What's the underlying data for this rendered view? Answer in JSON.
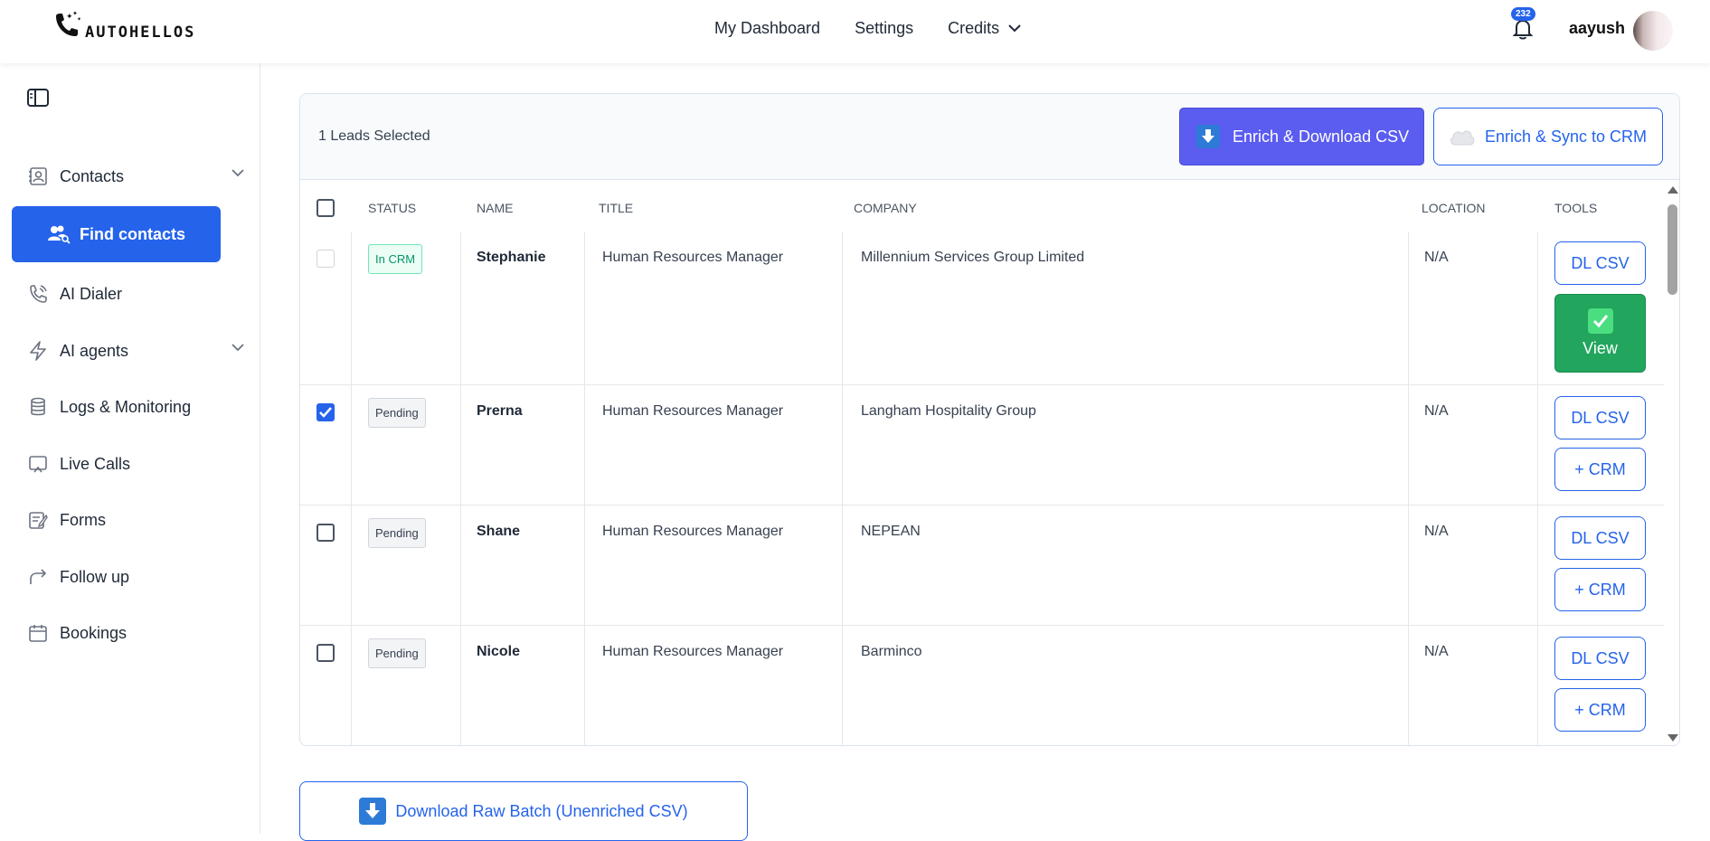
{
  "brand": {
    "logo_text": "AUTOHELLOS"
  },
  "nav": {
    "links": [
      "My Dashboard",
      "Settings",
      "Credits"
    ],
    "notifications_count": "232",
    "username": "aayush"
  },
  "sidebar": {
    "items": [
      {
        "label": "Contacts",
        "icon": "contacts-icon",
        "has_chevron": true
      },
      {
        "label": "Find contacts",
        "icon": "users-search-icon",
        "active": true
      },
      {
        "label": "AI Dialer",
        "icon": "phone-icon"
      },
      {
        "label": "AI agents",
        "icon": "bolt-icon",
        "has_chevron": true
      },
      {
        "label": "Logs & Monitoring",
        "icon": "database-icon"
      },
      {
        "label": "Live Calls",
        "icon": "cast-icon"
      },
      {
        "label": "Forms",
        "icon": "form-icon"
      },
      {
        "label": "Follow up",
        "icon": "share-icon"
      },
      {
        "label": "Bookings",
        "icon": "calendar-icon"
      }
    ]
  },
  "leads": {
    "selected_text": "1 Leads Selected",
    "enrich_download_label": "Enrich & Download CSV",
    "enrich_sync_label": "Enrich & Sync to CRM",
    "columns": [
      "STATUS",
      "NAME",
      "TITLE",
      "COMPANY",
      "LOCATION",
      "TOOLS"
    ],
    "rows": [
      {
        "checked": false,
        "disabled": true,
        "status": "In CRM",
        "name": "Stephanie",
        "title": "Human Resources Manager",
        "company": "Millennium Services Group Limited",
        "location": "N/A",
        "tool1": "DL CSV",
        "tool2": "View"
      },
      {
        "checked": true,
        "disabled": false,
        "status": "Pending",
        "name": "Prerna",
        "title": "Human Resources Manager",
        "company": "Langham Hospitality Group",
        "location": "N/A",
        "tool1": "DL CSV",
        "tool2": "+ CRM"
      },
      {
        "checked": false,
        "disabled": false,
        "status": "Pending",
        "name": "Shane",
        "title": "Human Resources Manager",
        "company": "NEPEAN",
        "location": "N/A",
        "tool1": "DL CSV",
        "tool2": "+ CRM"
      },
      {
        "checked": false,
        "disabled": false,
        "status": "Pending",
        "name": "Nicole",
        "title": "Human Resources Manager",
        "company": "Barminco",
        "location": "N/A",
        "tool1": "DL CSV",
        "tool2": "+ CRM"
      }
    ],
    "download_raw_label": "Download Raw Batch (Unenriched CSV)"
  },
  "colors": {
    "primary": "#2563eb",
    "enrich_button": "#5b5cf0",
    "view_button": "#22a55d",
    "in_crm_badge": "#059669"
  }
}
